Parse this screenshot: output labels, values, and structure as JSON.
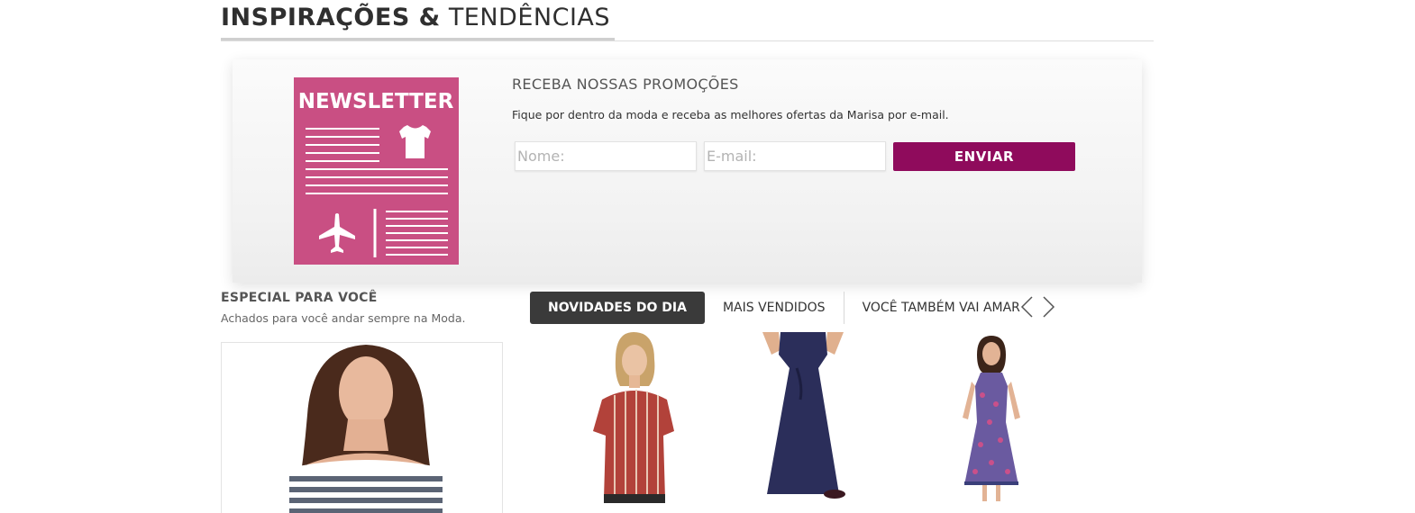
{
  "section": {
    "title_bold": "INSPIRAÇÕES &",
    "title_light": "TENDÊNCIAS"
  },
  "newsletter": {
    "icon_label": "NEWSLETTER",
    "heading": "RECEBA NOSSAS PROMOÇÕES",
    "description": "Fique por dentro da moda e receba as melhores ofertas da Marisa por e-mail.",
    "name_placeholder": "Nome:",
    "email_placeholder": "E-mail:",
    "submit_label": "ENVIAR"
  },
  "especial": {
    "title": "ESPECIAL PARA VOCÊ",
    "subtitle": "Achados para você andar sempre na Moda."
  },
  "tabs": [
    {
      "label": "NOVIDADES DO DIA",
      "active": true
    },
    {
      "label": "MAIS VENDIDOS",
      "active": false
    },
    {
      "label": "VOCÊ TAMBÉM VAI AMAR",
      "active": false
    }
  ],
  "colors": {
    "brand_purple": "#8f0b5c",
    "newsletter_pink": "#c94f83",
    "active_tab": "#3a3a3a"
  },
  "icons": {
    "prev": "chevron-left-icon",
    "next": "chevron-right-icon",
    "shirt": "tshirt-icon",
    "plane": "airplane-icon"
  }
}
